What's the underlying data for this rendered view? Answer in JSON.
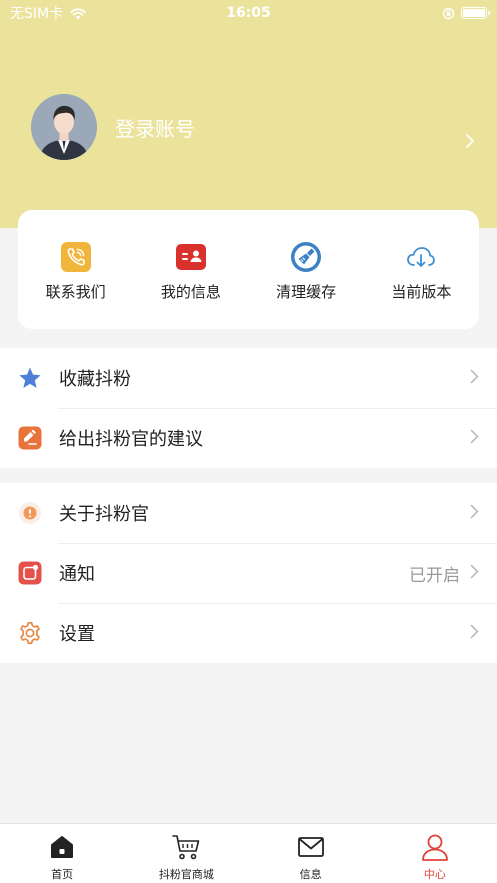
{
  "status_bar": {
    "carrier": "无SIM卡",
    "time": "16:05"
  },
  "profile": {
    "login_label": "登录账号"
  },
  "quick_actions": [
    {
      "label": "联系我们",
      "icon": "phone-icon",
      "color": "#f2b53c"
    },
    {
      "label": "我的信息",
      "icon": "id-card-icon",
      "color": "#d9322c"
    },
    {
      "label": "清理缓存",
      "icon": "broom-icon",
      "color": "#3b82c4"
    },
    {
      "label": "当前版本",
      "icon": "cloud-download-icon",
      "color": "#3f8fd2"
    }
  ],
  "menu": {
    "favorites": {
      "label": "收藏抖粉",
      "icon": "star-icon"
    },
    "feedback": {
      "label": "给出抖粉官的建议",
      "icon": "feedback-icon"
    },
    "about": {
      "label": "关于抖粉官",
      "icon": "info-icon"
    },
    "notify": {
      "label": "通知",
      "value": "已开启",
      "icon": "notification-icon"
    },
    "settings": {
      "label": "设置",
      "icon": "gear-icon"
    }
  },
  "tabs": [
    {
      "label": "首页",
      "icon": "home-icon"
    },
    {
      "label": "抖粉官商城",
      "icon": "cart-icon"
    },
    {
      "label": "信息",
      "icon": "mail-icon"
    },
    {
      "label": "中心",
      "icon": "person-icon",
      "active": true
    }
  ],
  "colors": {
    "header_bg": "#ebe39c",
    "accent": "#e0413a",
    "star": "#4d7fd8",
    "orange": "#e8743b"
  }
}
